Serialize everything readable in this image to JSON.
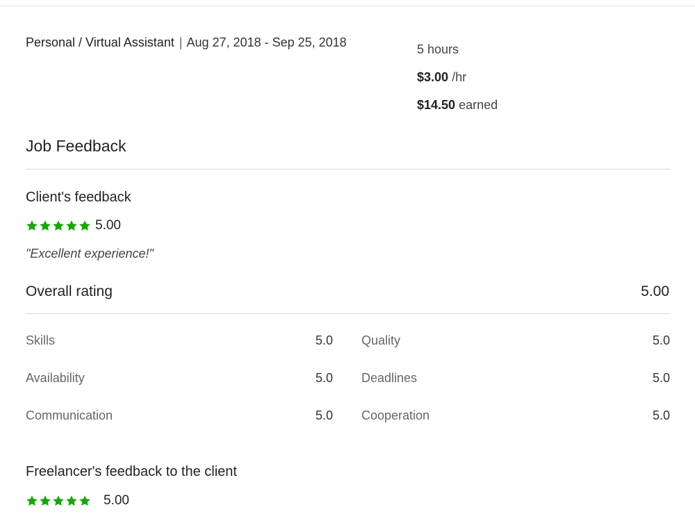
{
  "job": {
    "category": "Personal / Virtual Assistant",
    "separator": "|",
    "dates": "Aug 27, 2018 - Sep 25, 2018",
    "hours": "5 hours",
    "rate_amount": "$3.00",
    "rate_unit": "/hr",
    "earned_amount": "$14.50",
    "earned_label": "earned"
  },
  "feedback": {
    "section_title": "Job Feedback",
    "client": {
      "title": "Client's feedback",
      "stars": 5,
      "score": "5.00",
      "comment": "\"Excellent experience!\""
    },
    "overall": {
      "label": "Overall rating",
      "value": "5.00"
    },
    "metrics": [
      {
        "label": "Skills",
        "value": "5.0"
      },
      {
        "label": "Quality",
        "value": "5.0"
      },
      {
        "label": "Availability",
        "value": "5.0"
      },
      {
        "label": "Deadlines",
        "value": "5.0"
      },
      {
        "label": "Communication",
        "value": "5.0"
      },
      {
        "label": "Cooperation",
        "value": "5.0"
      }
    ],
    "freelancer": {
      "title": "Freelancer's feedback to the client",
      "stars": 5,
      "score": "5.00"
    }
  },
  "colors": {
    "star": "#14a800",
    "rule": "#d9d9d9",
    "muted_text": "#666666"
  },
  "icons": {
    "star": "star-icon"
  }
}
